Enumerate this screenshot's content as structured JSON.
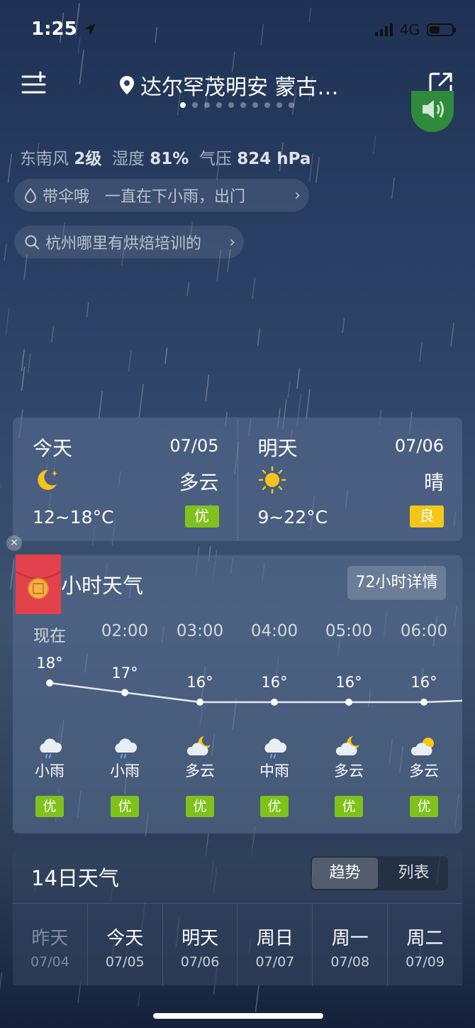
{
  "status": {
    "time": "1:25",
    "network": "4G"
  },
  "header": {
    "location": "达尔罕茂明安 蒙古…",
    "page_count": 10,
    "active_page": 0
  },
  "current": {
    "wind_label": "东南风",
    "wind_value": "2级",
    "humidity_label": "湿度",
    "humidity_value": "81%",
    "pressure_label": "气压",
    "pressure_value": "824 hPa",
    "tip": "带伞哦　一直在下小雨，出门",
    "search": "杭州哪里有烘焙培训的"
  },
  "days": [
    {
      "name": "今天",
      "date": "07/05",
      "condition": "多云",
      "temp": "12~18°C",
      "aqi": "优",
      "aqi_color": "#7fc21b",
      "icon": "moon-icon"
    },
    {
      "name": "明天",
      "date": "07/06",
      "condition": "晴",
      "temp": "9~22°C",
      "aqi": "良",
      "aqi_color": "#f5c518",
      "icon": "sun-icon"
    }
  ],
  "hourly": {
    "title": "小时天气",
    "detail_label": "72小时详情",
    "items": [
      {
        "time": "现在",
        "temp": "18°",
        "temp_value": 18,
        "cond": "小雨",
        "aqi": "优",
        "icon": "rain-cloud-icon"
      },
      {
        "time": "02:00",
        "temp": "17°",
        "temp_value": 17,
        "cond": "小雨",
        "aqi": "优",
        "icon": "rain-cloud-icon"
      },
      {
        "time": "03:00",
        "temp": "16°",
        "temp_value": 16,
        "cond": "多云",
        "aqi": "优",
        "icon": "cloudy-night-icon"
      },
      {
        "time": "04:00",
        "temp": "16°",
        "temp_value": 16,
        "cond": "中雨",
        "aqi": "优",
        "icon": "rain-cloud-icon"
      },
      {
        "time": "05:00",
        "temp": "16°",
        "temp_value": 16,
        "cond": "多云",
        "aqi": "优",
        "icon": "cloudy-night-icon"
      },
      {
        "time": "06:00",
        "temp": "16°",
        "temp_value": 16,
        "cond": "多云",
        "aqi": "优",
        "icon": "cloudy-day-icon"
      }
    ]
  },
  "forecast": {
    "title": "14日天气",
    "tab_trend": "趋势",
    "tab_list": "列表",
    "days": [
      {
        "name": "昨天",
        "date": "07/04"
      },
      {
        "name": "今天",
        "date": "07/05"
      },
      {
        "name": "明天",
        "date": "07/06"
      },
      {
        "name": "周日",
        "date": "07/07"
      },
      {
        "name": "周一",
        "date": "07/08"
      },
      {
        "name": "周二",
        "date": "07/09"
      }
    ]
  }
}
